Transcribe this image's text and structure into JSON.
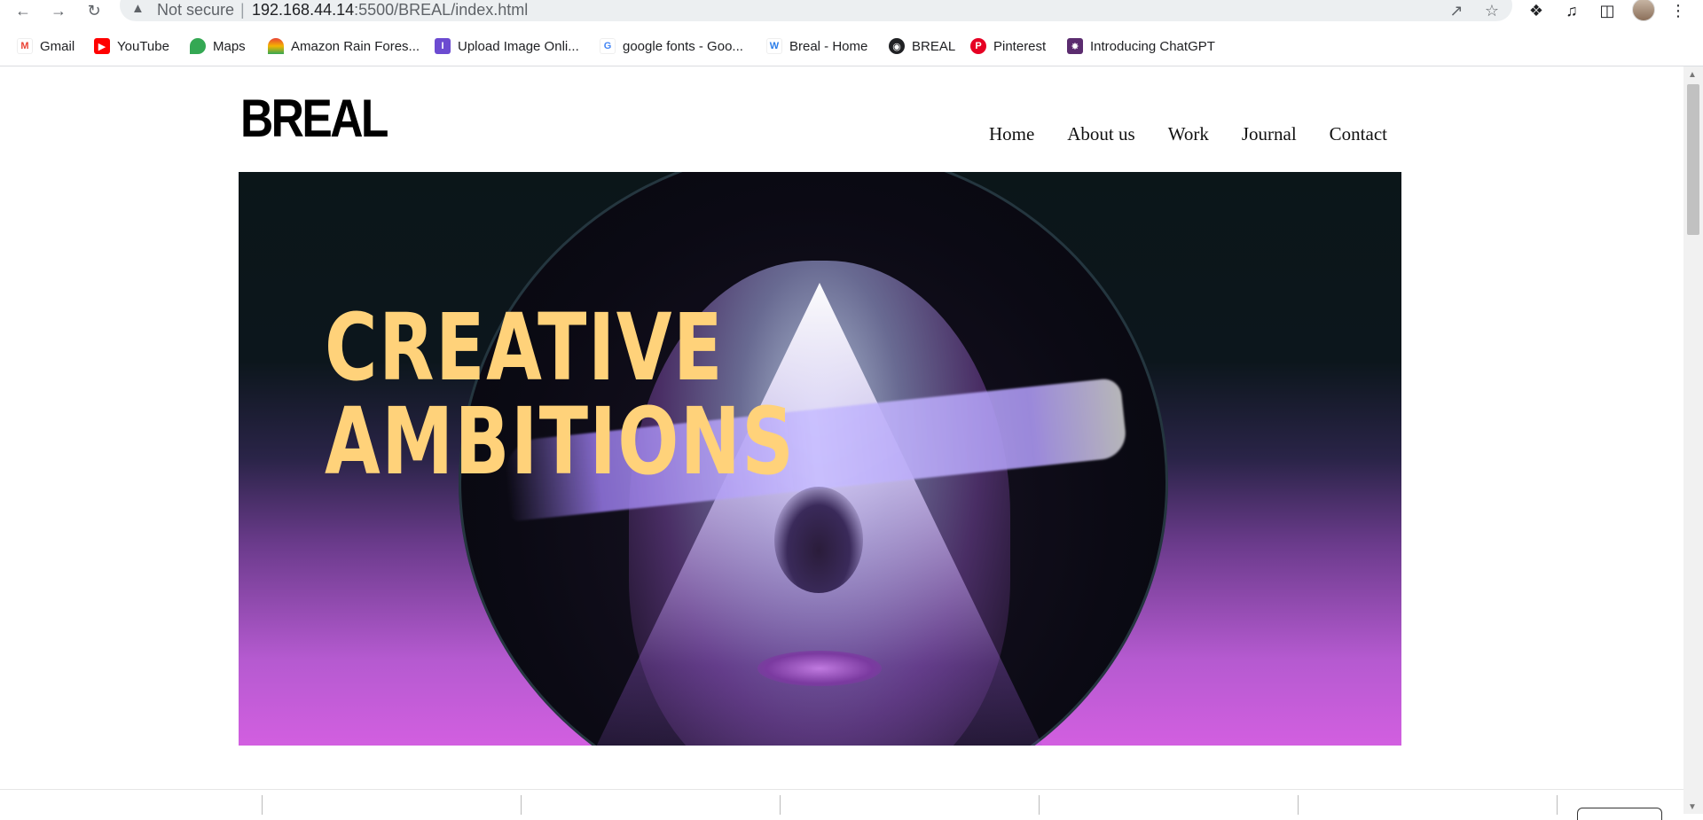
{
  "browser": {
    "security_label": "Not secure",
    "url_host": "192.168.44.14",
    "url_rest": ":5500/BREAL/index.html",
    "separator": "|",
    "icons": {
      "back": "back-arrow-icon",
      "forward": "forward-arrow-icon",
      "reload": "reload-icon",
      "warning": "warning-icon",
      "share": "share-icon",
      "star": "star-icon",
      "extensions": "puzzle-icon",
      "media": "media-queue-icon",
      "sidepanel": "side-panel-icon",
      "menu": "kebab-menu-icon"
    }
  },
  "bookmarks": [
    {
      "label": "Gmail",
      "icon": "gmail-icon",
      "color": "#ea4335"
    },
    {
      "label": "YouTube",
      "icon": "youtube-icon",
      "color": "#ff0000"
    },
    {
      "label": "Maps",
      "icon": "maps-icon",
      "color": "#34a853"
    },
    {
      "label": "Amazon Rain Fores...",
      "icon": "rainbow-icon",
      "color": "#f4b400"
    },
    {
      "label": "Upload Image Onli...",
      "icon": "upload-icon",
      "color": "#6c4bd1"
    },
    {
      "label": "google fonts - Goo...",
      "icon": "google-icon",
      "color": "#4285f4"
    },
    {
      "label": "Breal - Home",
      "icon": "weebly-icon",
      "color": "#2b7de9"
    },
    {
      "label": "BREAL",
      "icon": "globe-icon",
      "color": "#202124"
    },
    {
      "label": "Pinterest",
      "icon": "pinterest-icon",
      "color": "#e60023"
    },
    {
      "label": "Introducing ChatGPT",
      "icon": "chatgpt-icon",
      "color": "#5b2c6f"
    }
  ],
  "site": {
    "logo": "BREAL",
    "nav": [
      "Home",
      "About us",
      "Work",
      "Journal",
      "Contact"
    ],
    "hero": {
      "title_line1": "CREATIVE",
      "title_line2": "AMBITIONS",
      "accent_color": "#ffd27a"
    }
  }
}
